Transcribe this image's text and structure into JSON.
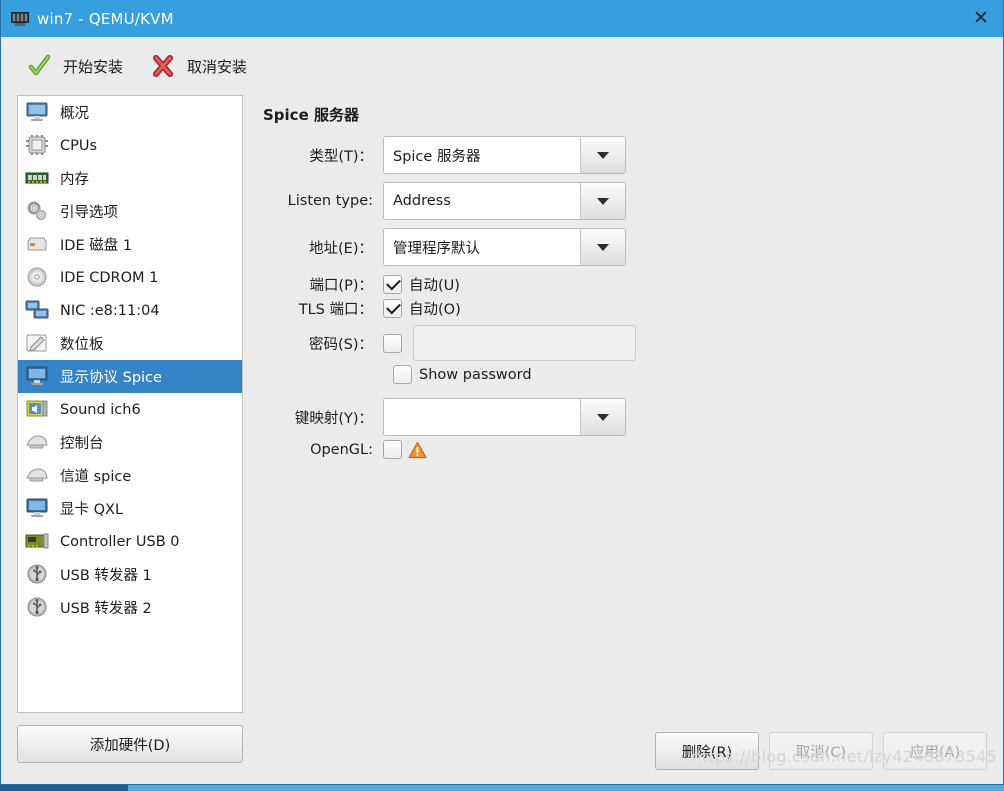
{
  "window": {
    "title": "win7 - QEMU/KVM",
    "title_icon": "computer-icon",
    "close_icon": "close-icon"
  },
  "toolbar": {
    "begin_install_label": "开始安装",
    "begin_install_icon": "green-check-icon",
    "cancel_install_label": "取消安装",
    "cancel_install_icon": "red-x-icon"
  },
  "hardware_list": {
    "items": [
      {
        "label": "概况",
        "icon": "monitor-icon",
        "selected": false
      },
      {
        "label": "CPUs",
        "icon": "cpu-chip-icon",
        "selected": false
      },
      {
        "label": "内存",
        "icon": "memory-ram-icon",
        "selected": false
      },
      {
        "label": "引导选项",
        "icon": "gears-icon",
        "selected": false
      },
      {
        "label": "IDE 磁盘 1",
        "icon": "hard-disk-icon",
        "selected": false
      },
      {
        "label": "IDE CDROM 1",
        "icon": "cdrom-disc-icon",
        "selected": false
      },
      {
        "label": "NIC :e8:11:04",
        "icon": "network-card-icon",
        "selected": false
      },
      {
        "label": "数位板",
        "icon": "tablet-pen-icon",
        "selected": false
      },
      {
        "label": "显示协议 Spice",
        "icon": "display-icon",
        "selected": true
      },
      {
        "label": "Sound ich6",
        "icon": "sound-card-icon",
        "selected": false
      },
      {
        "label": "控制台",
        "icon": "console-icon",
        "selected": false
      },
      {
        "label": "信道 spice",
        "icon": "channel-icon",
        "selected": false
      },
      {
        "label": "显卡 QXL",
        "icon": "video-card-icon",
        "selected": false
      },
      {
        "label": "Controller USB 0",
        "icon": "usb-controller-icon",
        "selected": false
      },
      {
        "label": "USB 转发器 1",
        "icon": "usb-redirector-icon",
        "selected": false
      },
      {
        "label": "USB 转发器 2",
        "icon": "usb-redirector-icon",
        "selected": false
      }
    ],
    "add_hardware_label": "添加硬件(D)"
  },
  "panel": {
    "title": "Spice 服务器",
    "fields": {
      "type_label": "类型(T)：",
      "type_value": "Spice 服务器",
      "listen_type_label": "Listen type:",
      "listen_type_value": "Address",
      "address_label": "地址(E)：",
      "address_value": "管理程序默认",
      "port_label": "端口(P)：",
      "port_auto_label": "自动(U)",
      "port_auto_checked": true,
      "tls_port_label": "TLS 端口：",
      "tls_auto_label": "自动(O)",
      "tls_auto_checked": true,
      "password_label": "密码(S)：",
      "password_checked": false,
      "password_value": "",
      "show_password_label": "Show password",
      "show_password_checked": false,
      "keymap_label": "键映射(Y)：",
      "keymap_value": "",
      "opengl_label": "OpenGL:",
      "opengl_checked": false,
      "opengl_warning_icon": "warning-triangle-icon"
    }
  },
  "footer": {
    "delete_label": "删除(R)",
    "cancel_label": "取消(C)",
    "apply_label": "应用(A)"
  },
  "watermark": "https://blog.csdn.net/lzy4248873545"
}
